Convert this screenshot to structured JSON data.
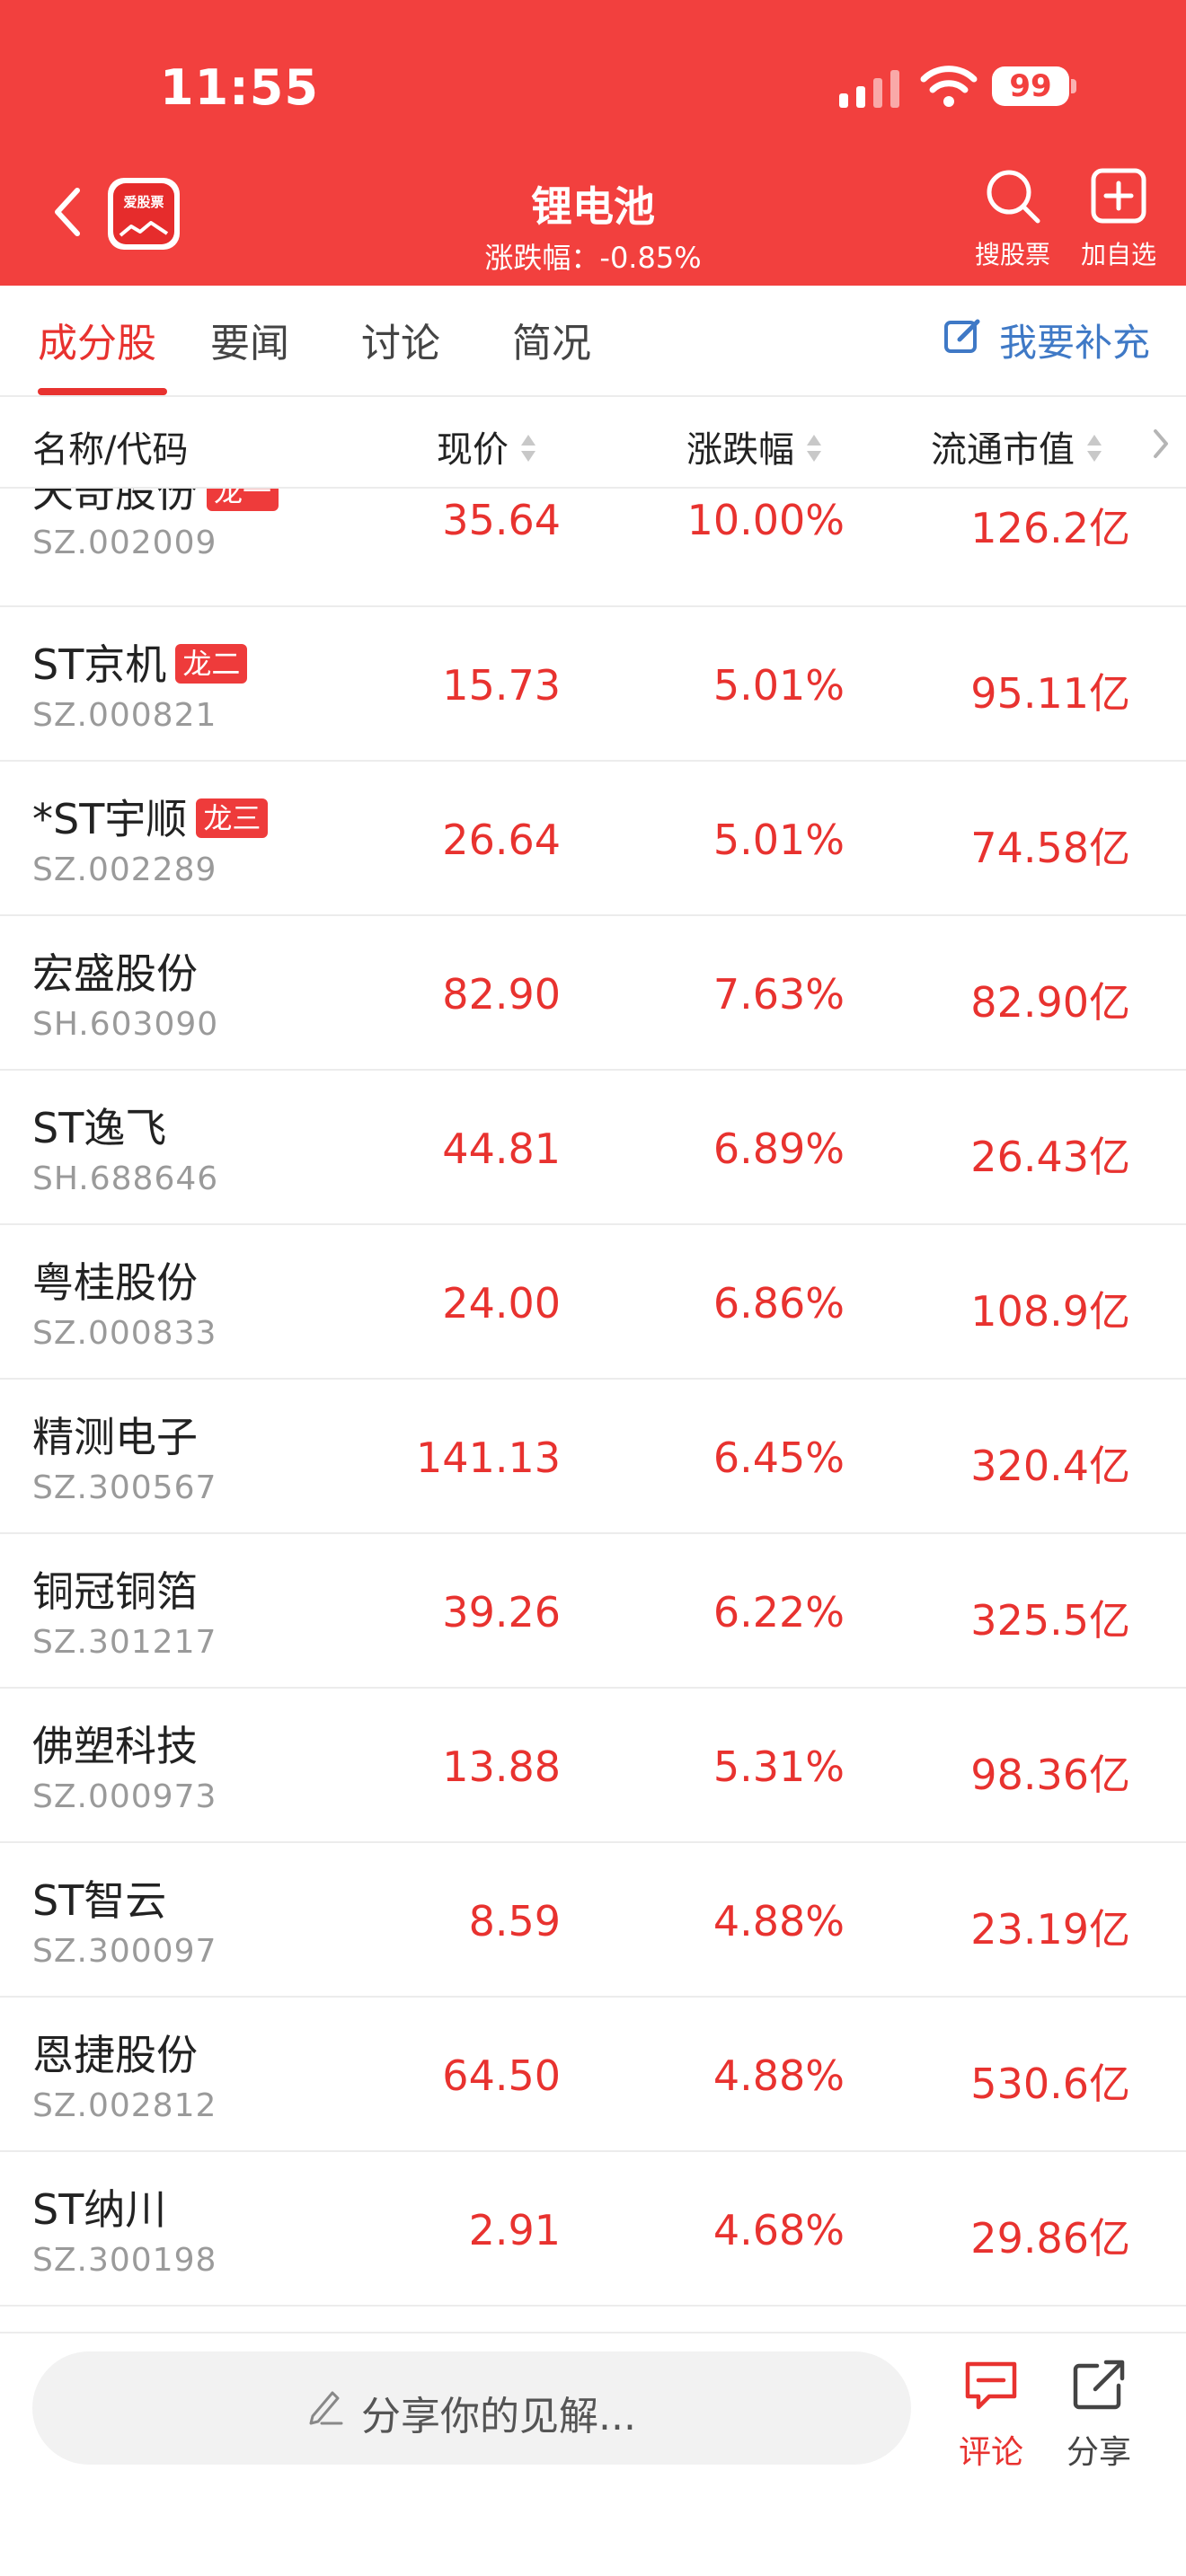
{
  "status_bar": {
    "time": "11:55",
    "battery": "99"
  },
  "header": {
    "title": "锂电池",
    "subtitle": "涨跌幅：-0.85%",
    "search_label": "搜股票",
    "add_label": "加自选",
    "logo_text": "爱股票"
  },
  "tabs": [
    {
      "label": "成分股",
      "active": true
    },
    {
      "label": "要闻",
      "active": false
    },
    {
      "label": "讨论",
      "active": false
    },
    {
      "label": "简况",
      "active": false
    }
  ],
  "supplement_label": "我要补充",
  "columns": {
    "name": "名称/代码",
    "price": "现价",
    "change": "涨跌幅",
    "cap": "流通市值"
  },
  "stocks": [
    {
      "name": "天奇股份",
      "badge": "龙一",
      "code": "SZ.002009",
      "price": "35.64",
      "change": "10.00%",
      "cap": "126.2亿"
    },
    {
      "name": "ST京机",
      "badge": "龙二",
      "code": "SZ.000821",
      "price": "15.73",
      "change": "5.01%",
      "cap": "95.11亿"
    },
    {
      "name": "*ST宇顺",
      "badge": "龙三",
      "code": "SZ.002289",
      "price": "26.64",
      "change": "5.01%",
      "cap": "74.58亿"
    },
    {
      "name": "宏盛股份",
      "badge": "",
      "code": "SH.603090",
      "price": "82.90",
      "change": "7.63%",
      "cap": "82.90亿"
    },
    {
      "name": "ST逸飞",
      "badge": "",
      "code": "SH.688646",
      "price": "44.81",
      "change": "6.89%",
      "cap": "26.43亿"
    },
    {
      "name": "粤桂股份",
      "badge": "",
      "code": "SZ.000833",
      "price": "24.00",
      "change": "6.86%",
      "cap": "108.9亿"
    },
    {
      "name": "精测电子",
      "badge": "",
      "code": "SZ.300567",
      "price": "141.13",
      "change": "6.45%",
      "cap": "320.4亿"
    },
    {
      "name": "铜冠铜箔",
      "badge": "",
      "code": "SZ.301217",
      "price": "39.26",
      "change": "6.22%",
      "cap": "325.5亿"
    },
    {
      "name": "佛塑科技",
      "badge": "",
      "code": "SZ.000973",
      "price": "13.88",
      "change": "5.31%",
      "cap": "98.36亿"
    },
    {
      "name": "ST智云",
      "badge": "",
      "code": "SZ.300097",
      "price": "8.59",
      "change": "4.88%",
      "cap": "23.19亿"
    },
    {
      "name": "恩捷股份",
      "badge": "",
      "code": "SZ.002812",
      "price": "64.50",
      "change": "4.88%",
      "cap": "530.6亿"
    },
    {
      "name": "ST纳川",
      "badge": "",
      "code": "SZ.300198",
      "price": "2.91",
      "change": "4.68%",
      "cap": "29.86亿"
    }
  ],
  "bottom_bar": {
    "share_placeholder": "分享你的见解...",
    "comment_label": "评论",
    "share_label": "分享"
  },
  "colors": {
    "brand_red": "#f2403e",
    "up_red": "#e8322f",
    "link_blue": "#3f79c6"
  }
}
